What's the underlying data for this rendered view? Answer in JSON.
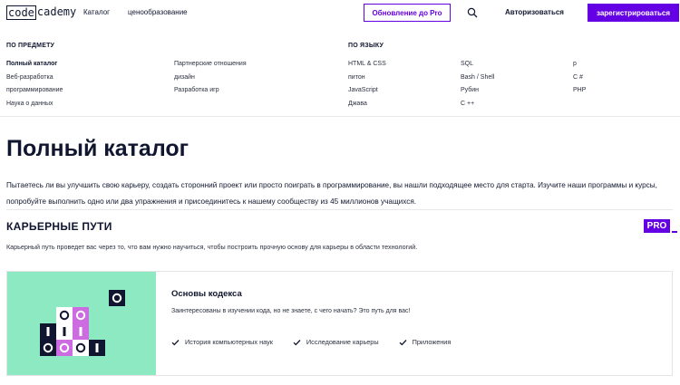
{
  "header": {
    "logo_left": "code",
    "logo_right": "cademy",
    "nav": [
      "Каталог",
      "ценообразование"
    ],
    "upgrade_label": "Обновление до Pro",
    "search_icon": "search-icon",
    "login_label": "Авторизоваться",
    "signup_label": "зарегистрироваться"
  },
  "menu": {
    "by_subject": {
      "heading": "ПО ПРЕДМЕТУ",
      "col1": [
        "Полный каталог",
        "Веб-разработка",
        "программирование",
        "Наука о данных"
      ],
      "col2": [
        "Партнерские отношения",
        "дизайн",
        "Разработка игр"
      ]
    },
    "by_language": {
      "heading": "ПО ЯЗЫКУ",
      "col1": [
        "HTML & CSS",
        "питон",
        "JavaScript",
        "Джава"
      ],
      "col2": [
        "SQL",
        "Bash / Shell",
        "Рубин",
        "C ++"
      ],
      "col3": [
        "р",
        "C #",
        "PHP"
      ]
    }
  },
  "page": {
    "title": "Полный каталог",
    "intro": "Пытаетесь ли вы улучшить свою карьеру, создать сторонний проект или просто поиграть в программирование, вы нашли подходящее место для старта. Изучите наши программы и курсы, попробуйте выполнить одно или два упражнения и присоединитесь к нашему сообществу из 45 миллионов учащихся."
  },
  "career": {
    "title": "КАРЬЕРНЫЕ ПУТИ",
    "badge": "PRO",
    "desc": "Карьерный путь проведет вас через то, что вам нужно научиться, чтобы построить прочную основу для карьеры в области технологий.",
    "card": {
      "title": "Основы кодекса",
      "desc": "Заинтересованы в изучении кода, но не знаете, с чего начать? Это путь для вас!",
      "checks": [
        "История компьютерных наук",
        "Исследование карьеры",
        "Приложения"
      ]
    }
  },
  "colors": {
    "accent": "#6400e4",
    "navy": "#10162f",
    "mint": "#8ce9c1",
    "pink": "#cc6ce0"
  }
}
